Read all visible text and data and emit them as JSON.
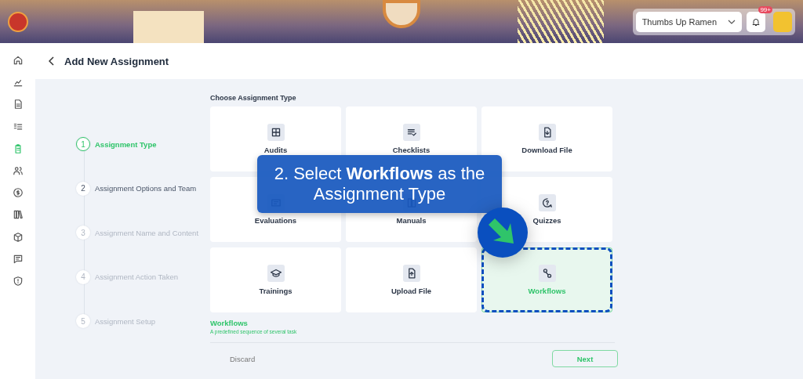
{
  "header": {
    "store_select": {
      "value": "Thumbs Up Ramen"
    },
    "notifications_badge": "99+"
  },
  "sidebar": {
    "items": [
      {
        "selected": false
      },
      {
        "selected": false
      },
      {
        "selected": false
      },
      {
        "selected": false
      },
      {
        "selected": true
      },
      {
        "selected": false
      },
      {
        "selected": false
      },
      {
        "selected": false
      },
      {
        "selected": false
      },
      {
        "selected": false
      },
      {
        "selected": false
      }
    ]
  },
  "page": {
    "title": "Add New Assignment"
  },
  "steps": [
    {
      "number": "1",
      "label": "Assignment Type",
      "selected": true,
      "disabled": false
    },
    {
      "number": "2",
      "label": "Assignment Options and Team",
      "selected": false,
      "disabled": false
    },
    {
      "number": "3",
      "label": "Assignment Name and Content",
      "selected": false,
      "disabled": true
    },
    {
      "number": "4",
      "label": "Assignment Action Taken",
      "selected": false,
      "disabled": true
    },
    {
      "number": "5",
      "label": "Assignment Setup",
      "selected": false,
      "disabled": true
    }
  ],
  "assignment_types": {
    "heading": "Choose Assignment Type",
    "options": [
      {
        "label": "Audits",
        "selected": false
      },
      {
        "label": "Checklists",
        "selected": false
      },
      {
        "label": "Download File",
        "selected": false
      },
      {
        "label": "Evaluations",
        "selected": false
      },
      {
        "label": "Manuals",
        "selected": false
      },
      {
        "label": "Quizzes",
        "selected": false
      },
      {
        "label": "Trainings",
        "selected": false
      },
      {
        "label": "Upload File",
        "selected": false
      },
      {
        "label": "Workflows",
        "selected": true
      }
    ]
  },
  "description": {
    "title": "Workflows",
    "text": "A predefined sequence of several task"
  },
  "buttons": {
    "discard": "Discard",
    "next": "Next"
  },
  "callout": {
    "text": "2. Select **Workflows** as the Assignment Type"
  }
}
